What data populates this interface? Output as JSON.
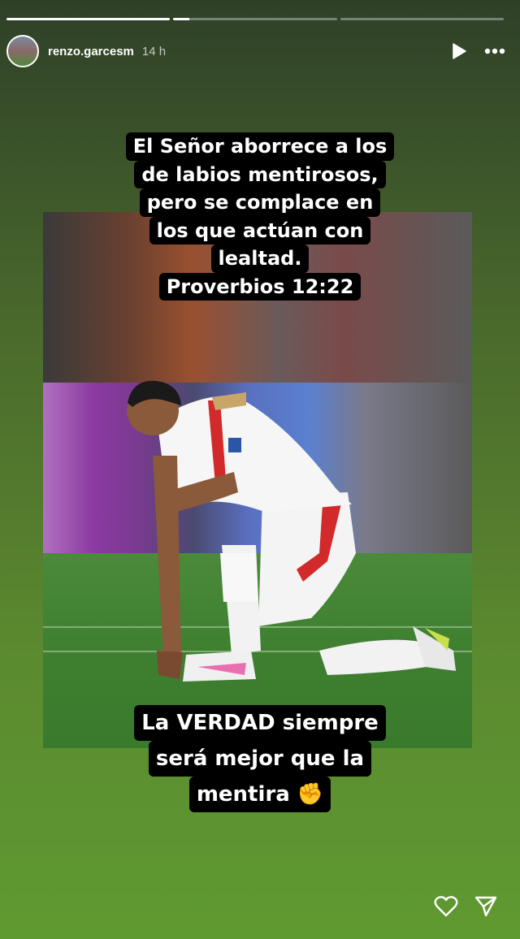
{
  "story": {
    "username": "renzo.garcesm",
    "time": "14 h",
    "progress": [
      1.0,
      0.1,
      0.0
    ]
  },
  "caption_top": {
    "lines": [
      "El Señor aborrece a los",
      "de labios mentirosos,",
      "pero se complace en",
      "los que actúan con",
      "lealtad.",
      "Proverbios 12:22"
    ]
  },
  "caption_bottom": {
    "lines": [
      "La VERDAD siempre",
      "será mejor que la",
      "mentira ✊"
    ]
  },
  "icons": {
    "play": "play-icon",
    "more": "more-icon",
    "like": "heart-icon",
    "share": "send-icon"
  }
}
